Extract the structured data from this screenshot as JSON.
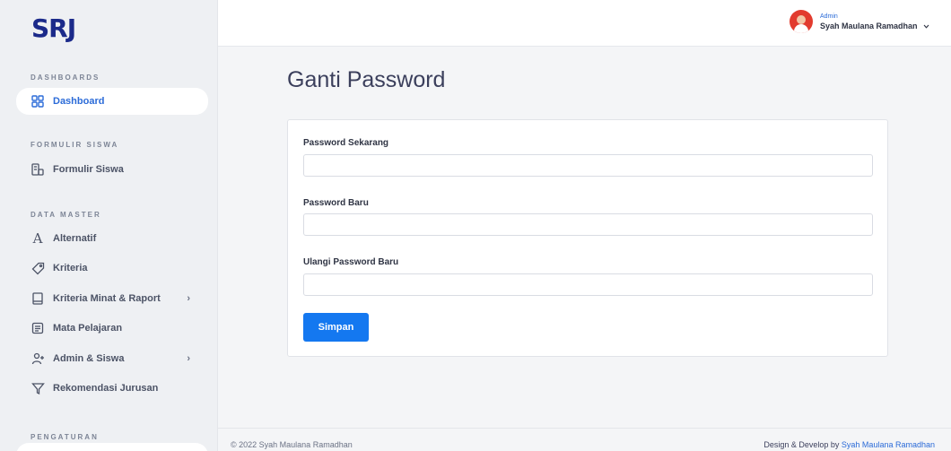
{
  "brand": {
    "logo": "SRJ"
  },
  "sidebar": {
    "sections": [
      {
        "title": "DASHBOARDS"
      },
      {
        "title": "FORMULIR SISWA"
      },
      {
        "title": "DATA MASTER"
      },
      {
        "title": "PENGATURAN"
      }
    ],
    "items": [
      {
        "label": "Dashboard",
        "icon": "grid-icon",
        "active": true
      },
      {
        "label": "Formulir Siswa",
        "icon": "form-icon"
      },
      {
        "label": "Alternatif",
        "icon": "letter-a-icon"
      },
      {
        "label": "Kriteria",
        "icon": "tag-icon"
      },
      {
        "label": "Kriteria Minat & Raport",
        "icon": "book-icon",
        "chevron": "›"
      },
      {
        "label": "Mata Pelajaran",
        "icon": "list-box-icon"
      },
      {
        "label": "Admin & Siswa",
        "icon": "user-add-icon",
        "chevron": "›"
      },
      {
        "label": "Rekomendasi Jurusan",
        "icon": "filter-icon"
      }
    ]
  },
  "header": {
    "user_role": "Admin",
    "user_name": "Syah Maulana Ramadhan",
    "dropdown_icon": "chevron-down-icon"
  },
  "main": {
    "title": "Ganti Password",
    "fields": [
      {
        "label": "Password Sekarang",
        "value": "",
        "placeholder": ""
      },
      {
        "label": "Password Baru",
        "value": "",
        "placeholder": ""
      },
      {
        "label": "Ulangi Password Baru",
        "value": "",
        "placeholder": ""
      }
    ],
    "submit_label": "Simpan"
  },
  "footer": {
    "copyright": "© 2022 Syah Maulana Ramadhan",
    "credits_prefix": "Design & Develop by ",
    "credits_link": "Syah Maulana Ramadhan"
  },
  "colors": {
    "accent": "#2b6bd8",
    "button": "#1478f0",
    "sidebar_bg": "#eef0f3",
    "page_bg": "#f4f5f7"
  }
}
